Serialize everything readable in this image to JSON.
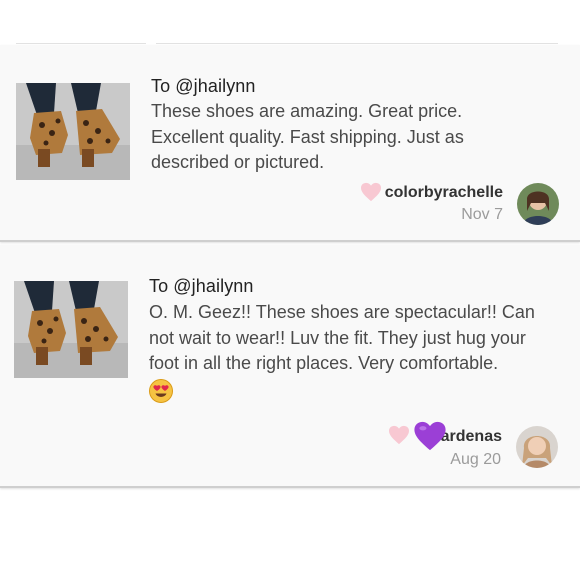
{
  "comments": [
    {
      "recipient": "To @jhailynn",
      "review_lines": [
        "These shoes are amazing. Great price.",
        "Excellent quality. Fast shipping. Just as",
        "described or pictured."
      ],
      "username": "colorbyrachelle",
      "date": "Nov 7",
      "thumbnail_icon": "leopard-bootie-photo",
      "like_icon": "heart-icon",
      "avatar_icon": "user-avatar"
    },
    {
      "recipient": "To @jhailynn",
      "review_lines": [
        "O. M. Geez!! These shoes are spectacular!! Can",
        "not wait to wear!! Luv the fit. They just hug your",
        "foot in all the right places. Very comfortable."
      ],
      "emoji_icon": "heart-eyes-emoji",
      "username": "ardenas",
      "date": "Aug 20",
      "thumbnail_icon": "leopard-bootie-photo",
      "like_icon": "heart-icon",
      "overlay_icon": "purple-heart-emoji",
      "avatar_icon": "user-avatar"
    }
  ],
  "colors": {
    "like_heart": "#f8c8d2",
    "purple_heart": "#9b3fd6",
    "text_primary": "#222222",
    "text_secondary": "#4a4a4a",
    "date": "#9b9b9b"
  }
}
